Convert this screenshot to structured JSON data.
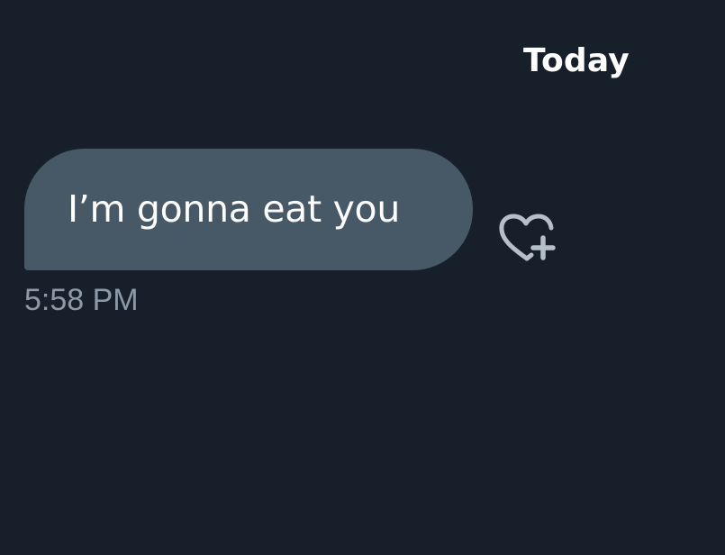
{
  "conversation": {
    "day_separator": "Today",
    "messages": [
      {
        "text": "I’m gonna eat you",
        "time": "5:58 PM",
        "reaction_icon": "heart-plus-icon"
      }
    ]
  },
  "colors": {
    "background": "#17202a",
    "bubble": "#475867",
    "text": "#ffffff",
    "timestamp": "#8d99a6",
    "icon": "#b4bfc9"
  }
}
